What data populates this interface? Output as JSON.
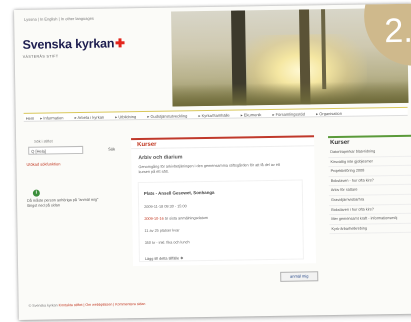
{
  "top_links": "Lyssna | In English | In other languages",
  "logo": {
    "name": "Svenska kyrkan",
    "sub": "VÄSTERÅS STIFT"
  },
  "badge": "2.",
  "nav": [
    "Hem",
    "Information",
    "Arbeta i kyrkan",
    "Utbildning",
    "Gudstjänstutveckling",
    "Kyrka/Samhälle",
    "Ekumenik",
    "Församlingsstöd",
    "Organisation"
  ],
  "search": {
    "label": "Sök i stiftet",
    "value": "Q [Hela]",
    "go_label": "Sök",
    "advanced": "Utökad sökfunktion"
  },
  "info": {
    "icon": "i",
    "text": "Då måste person anhöriga på \"anmäl mig\" längst ned på sidan"
  },
  "main": {
    "header": "Kurser",
    "title": "Arbiv och diarium",
    "description": "Genomgång för arkivbetjäningen i den gemensamma stiftsgården för att få del av ett kursen på ett sätt.",
    "place": "Plats - Ansell Gesowet, Sonhanga",
    "lines": [
      {
        "prefix": "",
        "text": "2009-11-18 09:30 - 15:00"
      },
      {
        "prefix": "2009-10-16",
        "text": " är sista anmälningsdatum"
      },
      {
        "prefix": "",
        "text": "11 av 25 platser kvar"
      },
      {
        "prefix": "",
        "text": "350 kr - inkl. fika och lunch"
      }
    ],
    "add_link": "Lägg till detta tillfälle ❖",
    "signup": "anmäl mig"
  },
  "side": {
    "header": "Kurser",
    "items": [
      "Datortraperkar blatvridning",
      "Kirsvattig inte gjobjesmer",
      "Projektinföring 2008",
      "Bokstaven - hur ofta kirs?",
      "Arkiv för sattare",
      "Gravidjärnvisbarhra",
      "Bokstaven i hur ofta kirs?",
      "Mer gemensamt kraft - informationsmöj",
      "Kyrk-ärbarhetkrebing"
    ]
  },
  "footer": {
    "prefix": "© Svenska kyrkan ",
    "links": "Kontakta stiftet | Om webbplatsen | Kommentera sidan"
  },
  "colors": {
    "brand_red": "#c0341d",
    "badge": "#cfb98c",
    "accent_green": "#5a9a3a",
    "logo_navy": "#1d1d4f"
  }
}
